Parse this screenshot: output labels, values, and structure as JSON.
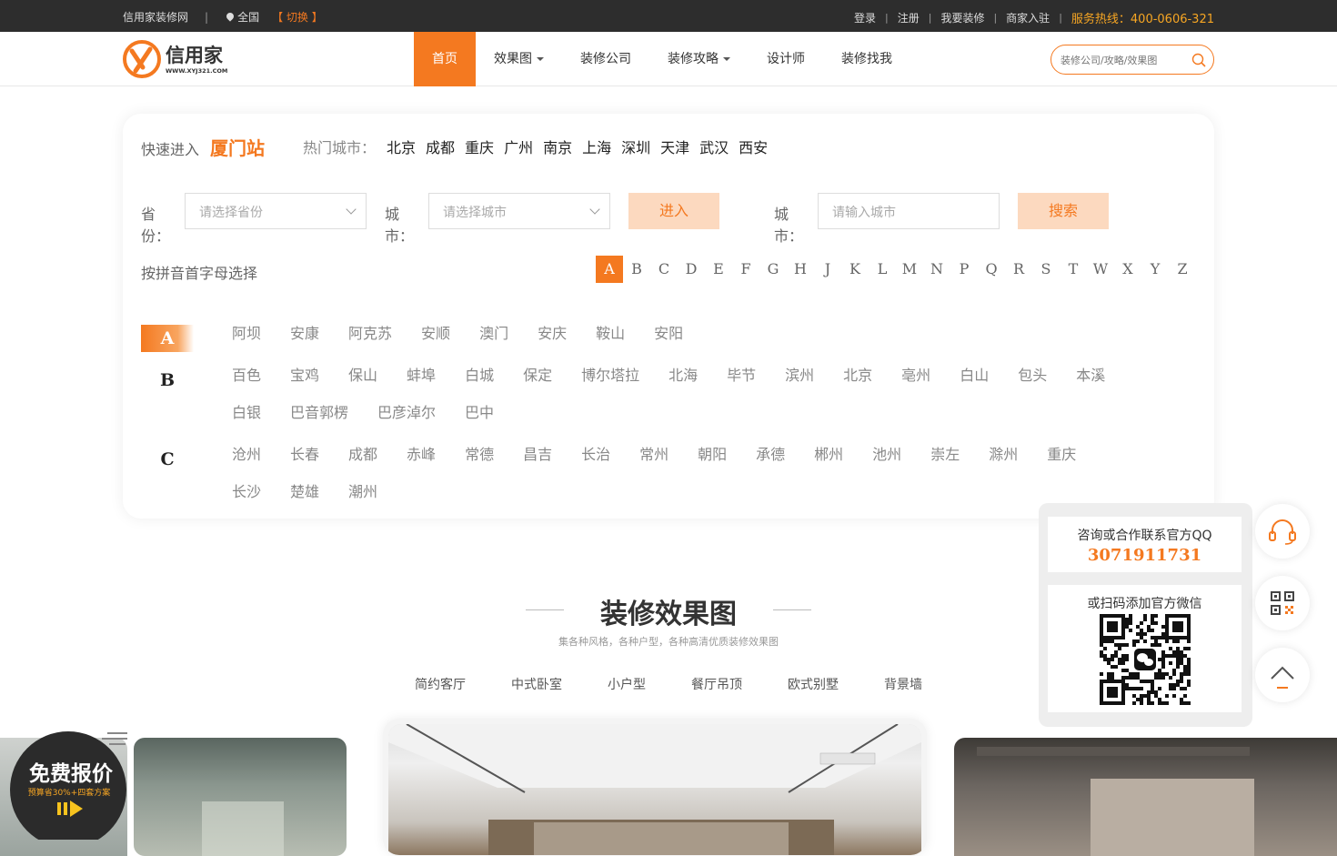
{
  "topbar": {
    "site_name": "信用家装修网",
    "divider": "|",
    "location": "全国",
    "switch": "【 切换 】",
    "links": [
      "登录",
      "注册",
      "我要装修",
      "商家入驻"
    ],
    "link_sep": "|",
    "hotline": "服务热线：400-0606-321"
  },
  "header": {
    "logo_text": "信用家",
    "logo_url_text": "WWW.XYJ321.COM",
    "nav": [
      {
        "label": "首页",
        "dropdown": false,
        "active": true
      },
      {
        "label": "效果图",
        "dropdown": true
      },
      {
        "label": "装修公司",
        "dropdown": false
      },
      {
        "label": "装修攻略",
        "dropdown": true
      },
      {
        "label": "设计师",
        "dropdown": false
      },
      {
        "label": "装修找我",
        "dropdown": false
      }
    ],
    "search_placeholder": "装修公司/攻略/效果图"
  },
  "city": {
    "quick_label": "快速进入",
    "current": "厦门站",
    "hot_label": "热门城市：",
    "hot_cities": [
      "北京",
      "成都",
      "重庆",
      "广州",
      "南京",
      "上海",
      "深圳",
      "天津",
      "武汉",
      "西安"
    ],
    "province_label": "省份：",
    "province_placeholder": "请选择省份",
    "city_label": "城市：",
    "city_placeholder": "请选择城市",
    "enter_button": "进入",
    "city_search_label": "城市：",
    "city_input_placeholder": "请输入城市",
    "search_button": "搜索",
    "pinyin_label": "按拼音首字母选择",
    "letters": [
      "A",
      "B",
      "C",
      "D",
      "E",
      "F",
      "G",
      "H",
      "J",
      "K",
      "L",
      "M",
      "N",
      "P",
      "Q",
      "R",
      "S",
      "T",
      "W",
      "X",
      "Y",
      "Z"
    ],
    "active_letter": "A",
    "groups": [
      {
        "letter": "A",
        "cities": [
          "阿坝",
          "安康",
          "阿克苏",
          "安顺",
          "澳门",
          "安庆",
          "鞍山",
          "安阳"
        ]
      },
      {
        "letter": "B",
        "cities": [
          "百色",
          "宝鸡",
          "保山",
          "蚌埠",
          "白城",
          "保定",
          "博尔塔拉",
          "北海",
          "毕节",
          "滨州",
          "北京",
          "亳州",
          "白山",
          "包头",
          "本溪",
          "白银",
          "巴音郭楞",
          "巴彦淖尔",
          "巴中"
        ]
      },
      {
        "letter": "C",
        "cities": [
          "沧州",
          "长春",
          "成都",
          "赤峰",
          "常德",
          "昌吉",
          "长治",
          "常州",
          "朝阳",
          "承德",
          "郴州",
          "池州",
          "崇左",
          "滁州",
          "重庆",
          "长沙",
          "楚雄",
          "潮州"
        ]
      }
    ]
  },
  "effects": {
    "title": "装修效果图",
    "subtitle": "集各种风格，各种户型，各种高清优质装修效果图",
    "tabs": [
      "简约客厅",
      "中式卧室",
      "小户型",
      "餐厅吊顶",
      "欧式别墅",
      "背景墙"
    ]
  },
  "badge": {
    "title": "免费报价",
    "sub": "预算省30%+四套方案"
  },
  "float_panel": {
    "qq_label": "咨询或合作联系官方QQ",
    "qq_number": "3071911731",
    "wechat_label": "或扫码添加官方微信"
  },
  "colors": {
    "accent": "#f47920",
    "hotline": "#f7a623",
    "topbar_bg": "#2d2d2d"
  }
}
